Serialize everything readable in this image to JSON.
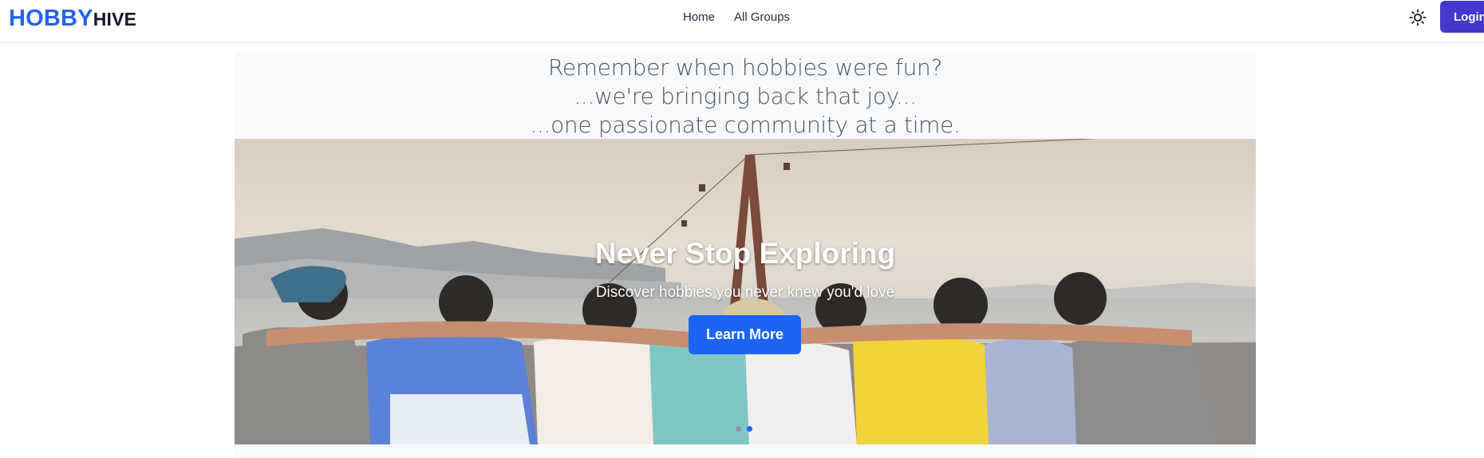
{
  "navbar": {
    "logo": {
      "part1": "HOBBY",
      "part2": "HIVE"
    },
    "links": [
      {
        "label": "Home"
      },
      {
        "label": "All Groups"
      }
    ],
    "theme_toggle_icon": "sun-icon",
    "login_label": "Login",
    "colors": {
      "logo_blue": "#2563eb",
      "login_bg": "#4338ca"
    }
  },
  "tagline": {
    "line1": "Remember when hobbies were fun?",
    "line2": "...we're bringing back that joy...",
    "line3": "...one passionate community at a time."
  },
  "hero": {
    "title": "Never Stop Exploring",
    "subtitle": "Discover hobbies you never knew you'd love",
    "cta_label": "Learn More",
    "slides_count": 2,
    "active_slide": 2,
    "colors": {
      "cta_bg": "#1d63f5",
      "dot_active": "#2563eb",
      "dot_inactive": "#8a98a8"
    }
  }
}
